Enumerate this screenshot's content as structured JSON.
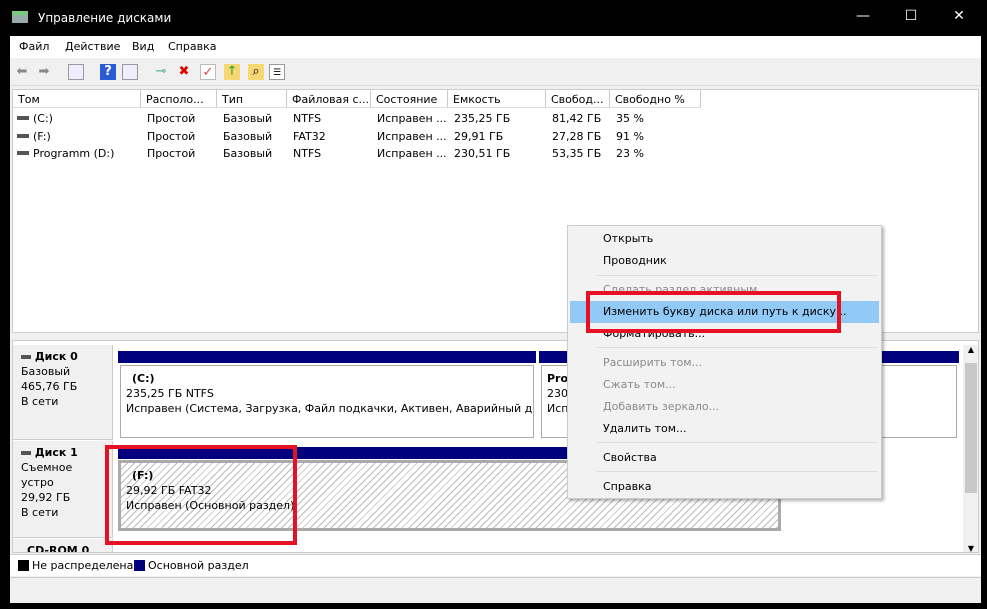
{
  "window": {
    "title": "Управление дисками",
    "minimize": "—",
    "maximize": "☐",
    "close": "✕"
  },
  "menu": [
    "Файл",
    "Действие",
    "Вид",
    "Справка"
  ],
  "toolbar": [
    "back-icon",
    "forward-icon",
    "console-tree-icon",
    "help-icon",
    "action-pane-icon",
    "connect-disk-icon",
    "delete-icon",
    "properties-icon",
    "folder-up-icon",
    "folder-search-icon",
    "list-icon"
  ],
  "columns": [
    "Том",
    "Располо...",
    "Тип",
    "Файловая с...",
    "Состояние",
    "Емкость",
    "Свобод...",
    "Свободно %"
  ],
  "volumes": [
    {
      "name": "(C:)",
      "layout": "Простой",
      "type": "Базовый",
      "fs": "NTFS",
      "status": "Исправен ...",
      "capacity": "235,25 ГБ",
      "free": "81,42 ГБ",
      "pct": "35 %"
    },
    {
      "name": "(F:)",
      "layout": "Простой",
      "type": "Базовый",
      "fs": "FAT32",
      "status": "Исправен ...",
      "capacity": "29,91 ГБ",
      "free": "27,28 ГБ",
      "pct": "91 %"
    },
    {
      "name": "Programm (D:)",
      "layout": "Простой",
      "type": "Базовый",
      "fs": "NTFS",
      "status": "Исправен ...",
      "capacity": "230,51 ГБ",
      "free": "53,35 ГБ",
      "pct": "23 %"
    }
  ],
  "disks": [
    {
      "name": "Диск 0",
      "type": "Базовый",
      "size": "465,76 ГБ",
      "state": "В сети",
      "partitions": [
        {
          "label": "(C:)",
          "size": "235,25 ГБ NTFS",
          "status": "Исправен (Система, Загрузка, Файл подкачки, Активен, Аварийный дамп"
        },
        {
          "label": "Prog",
          "size": "230,",
          "status": "Исп"
        }
      ]
    },
    {
      "name": "Диск 1",
      "type": "Съемное устро",
      "size": "29,92 ГБ",
      "state": "В сети",
      "partitions": [
        {
          "label": "(F:)",
          "size": "29,92 ГБ FAT32",
          "status": "Исправен (Основной раздел)"
        }
      ]
    },
    {
      "name": "CD-ROM 0"
    }
  ],
  "legend": [
    {
      "label": "Не распределена",
      "color": "#000000"
    },
    {
      "label": "Основной раздел",
      "color": "#00007f"
    }
  ],
  "context_menu": [
    {
      "label": "Открыть",
      "enabled": true
    },
    {
      "label": "Проводник",
      "enabled": true
    },
    {
      "label": "Сделать раздел активным",
      "enabled": false
    },
    {
      "label": "Изменить букву диска или путь к диску...",
      "enabled": true,
      "highlighted": true
    },
    {
      "label": "Форматировать...",
      "enabled": true
    },
    {
      "label": "Расширить том...",
      "enabled": false
    },
    {
      "label": "Сжать том...",
      "enabled": false
    },
    {
      "label": "Добавить зеркало...",
      "enabled": false
    },
    {
      "label": "Удалить том...",
      "enabled": true
    },
    {
      "label": "Свойства",
      "enabled": true
    },
    {
      "label": "Справка",
      "enabled": true
    }
  ],
  "colors": {
    "highlight": "#91c9f7",
    "annotation": "#e81123",
    "primary_partition": "#00007f"
  }
}
